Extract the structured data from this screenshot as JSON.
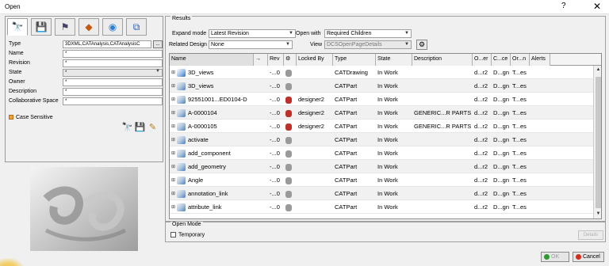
{
  "window": {
    "title": "Open",
    "help": "?",
    "close": "✕"
  },
  "search_tabs": [
    {
      "icon": "binoculars-icon",
      "glyph": "🔭"
    },
    {
      "icon": "save-db-icon",
      "glyph": "💾"
    },
    {
      "icon": "flag-icon",
      "glyph": "⚑"
    },
    {
      "icon": "shapes-icon",
      "glyph": "◆"
    },
    {
      "icon": "globe-icon",
      "glyph": "◉"
    },
    {
      "icon": "network-icon",
      "glyph": "⧉"
    }
  ],
  "criteria": {
    "type_label": "Type",
    "type_value": "3DXML,CATAnalysis,CATAnalysisC",
    "name_label": "Name",
    "name_value": "*",
    "revision_label": "Revision",
    "revision_value": "*",
    "state_label": "State",
    "state_value": "*",
    "owner_label": "Owner",
    "owner_value": "*",
    "description_label": "Description",
    "description_value": "*",
    "collab_label": "Collaborative Space",
    "collab_value": "*",
    "case_sensitive": "Case Sensitive"
  },
  "results": {
    "legend": "Results",
    "expand_mode_label": "Expand mode",
    "expand_mode_value": "Latest Revision",
    "open_with_label": "Open with",
    "open_with_value": "Required Children",
    "related_design_label": "Related Design",
    "related_design_value": "None",
    "view_label": "View",
    "view_value": "DCSOpenPageDetails",
    "columns": [
      "Name",
      "→",
      "Rev",
      "",
      "Locked By",
      "Type",
      "State",
      "Description",
      "O...er",
      "C...ce",
      "Or...n",
      "Alerts"
    ],
    "rows": [
      {
        "name": "3D_views",
        "rev": "-...0",
        "locked": "",
        "type": "CATDrawing",
        "state": "In Work",
        "desc": "",
        "owner": "d...r2",
        "coll": "D...gn",
        "org": "T...es",
        "lock": "grey",
        "icon": "drawing"
      },
      {
        "name": "3D_views",
        "rev": "-...0",
        "locked": "",
        "type": "CATPart",
        "state": "In Work",
        "desc": "",
        "owner": "d...r2",
        "coll": "D...gn",
        "org": "T...es",
        "lock": "grey",
        "icon": "part"
      },
      {
        "name": "92551001...ED0104-D",
        "rev": "-...0",
        "locked": "designer2",
        "type": "CATPart",
        "state": "In Work",
        "desc": "",
        "owner": "d...r2",
        "coll": "D...gn",
        "org": "T...es",
        "lock": "red",
        "icon": "part"
      },
      {
        "name": "A-0000104",
        "rev": "-...0",
        "locked": "designer2",
        "type": "CATPart",
        "state": "In Work",
        "desc": "GENERIC...R PARTS",
        "owner": "d...r2",
        "coll": "D...gn",
        "org": "T...es",
        "lock": "red",
        "icon": "part"
      },
      {
        "name": "A-0000105",
        "rev": "-...0",
        "locked": "designer2",
        "type": "CATPart",
        "state": "In Work",
        "desc": "GENERIC...R PARTS",
        "owner": "d...r2",
        "coll": "D...gn",
        "org": "T...es",
        "lock": "red",
        "icon": "part"
      },
      {
        "name": "activate",
        "rev": "-...0",
        "locked": "",
        "type": "CATPart",
        "state": "In Work",
        "desc": "",
        "owner": "d...r2",
        "coll": "D...gn",
        "org": "T...es",
        "lock": "grey",
        "icon": "part"
      },
      {
        "name": "add_component",
        "rev": "-...0",
        "locked": "",
        "type": "CATPart",
        "state": "In Work",
        "desc": "",
        "owner": "d...r2",
        "coll": "D...gn",
        "org": "T...es",
        "lock": "grey",
        "icon": "part"
      },
      {
        "name": "add_geometry",
        "rev": "-...0",
        "locked": "",
        "type": "CATPart",
        "state": "In Work",
        "desc": "",
        "owner": "d...r2",
        "coll": "D...gn",
        "org": "T...es",
        "lock": "grey",
        "icon": "part"
      },
      {
        "name": "Angle",
        "rev": "-...0",
        "locked": "",
        "type": "CATPart",
        "state": "In Work",
        "desc": "",
        "owner": "d...r2",
        "coll": "D...gn",
        "org": "T...es",
        "lock": "grey",
        "icon": "part"
      },
      {
        "name": "annotation_link",
        "rev": "-...0",
        "locked": "",
        "type": "CATPart",
        "state": "In Work",
        "desc": "",
        "owner": "d...r2",
        "coll": "D...gn",
        "org": "T...es",
        "lock": "grey",
        "icon": "part"
      },
      {
        "name": "attribute_link",
        "rev": "-...0",
        "locked": "",
        "type": "CATPart",
        "state": "In Work",
        "desc": "",
        "owner": "d...r2",
        "coll": "D...gn",
        "org": "T...es",
        "lock": "grey",
        "icon": "part"
      }
    ]
  },
  "open_mode": {
    "legend": "Open Mode",
    "temporary": "Temporary",
    "details": "Details"
  },
  "buttons": {
    "ok": "OK",
    "cancel": "Cancel"
  },
  "colors": {
    "ok_green": "#2e9a2e",
    "cancel_red": "#d03020",
    "lock_red": "#c0302a",
    "lock_grey": "#9a9a9a"
  }
}
